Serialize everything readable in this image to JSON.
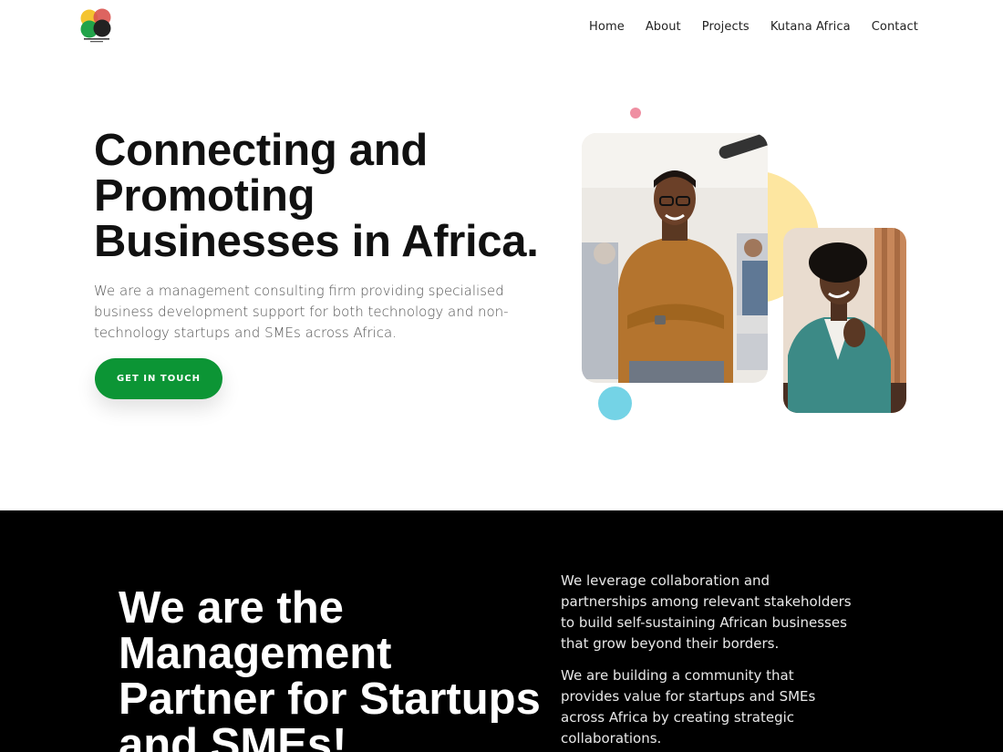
{
  "header": {
    "logo_alt": "START UP COURSE AFRICA",
    "nav": [
      "Home",
      "About",
      "Projects",
      "Kutana Africa",
      "Contact"
    ]
  },
  "hero": {
    "title": "Connecting and Promoting Businesses in Africa.",
    "description": "We are a management consulting firm providing specialised business development support for both technology and non-technology startups and SMEs across Africa.",
    "cta": "GET IN TOUCH"
  },
  "about": {
    "title": "We are the Management Partner for Startups and SMEs!",
    "paragraph_1": "We leverage collaboration and partnerships among relevant stakeholders to build self-sustaining African businesses that grow beyond their borders.",
    "paragraph_2": "We are building a community that provides value for startups and SMEs across Africa by creating strategic collaborations."
  },
  "colors": {
    "brand_green": "#0c9535",
    "accent_yellow": "#fde6a0",
    "accent_pink": "#ef8fa2",
    "accent_blue": "#74d3e6",
    "dark_bg": "#000000"
  }
}
